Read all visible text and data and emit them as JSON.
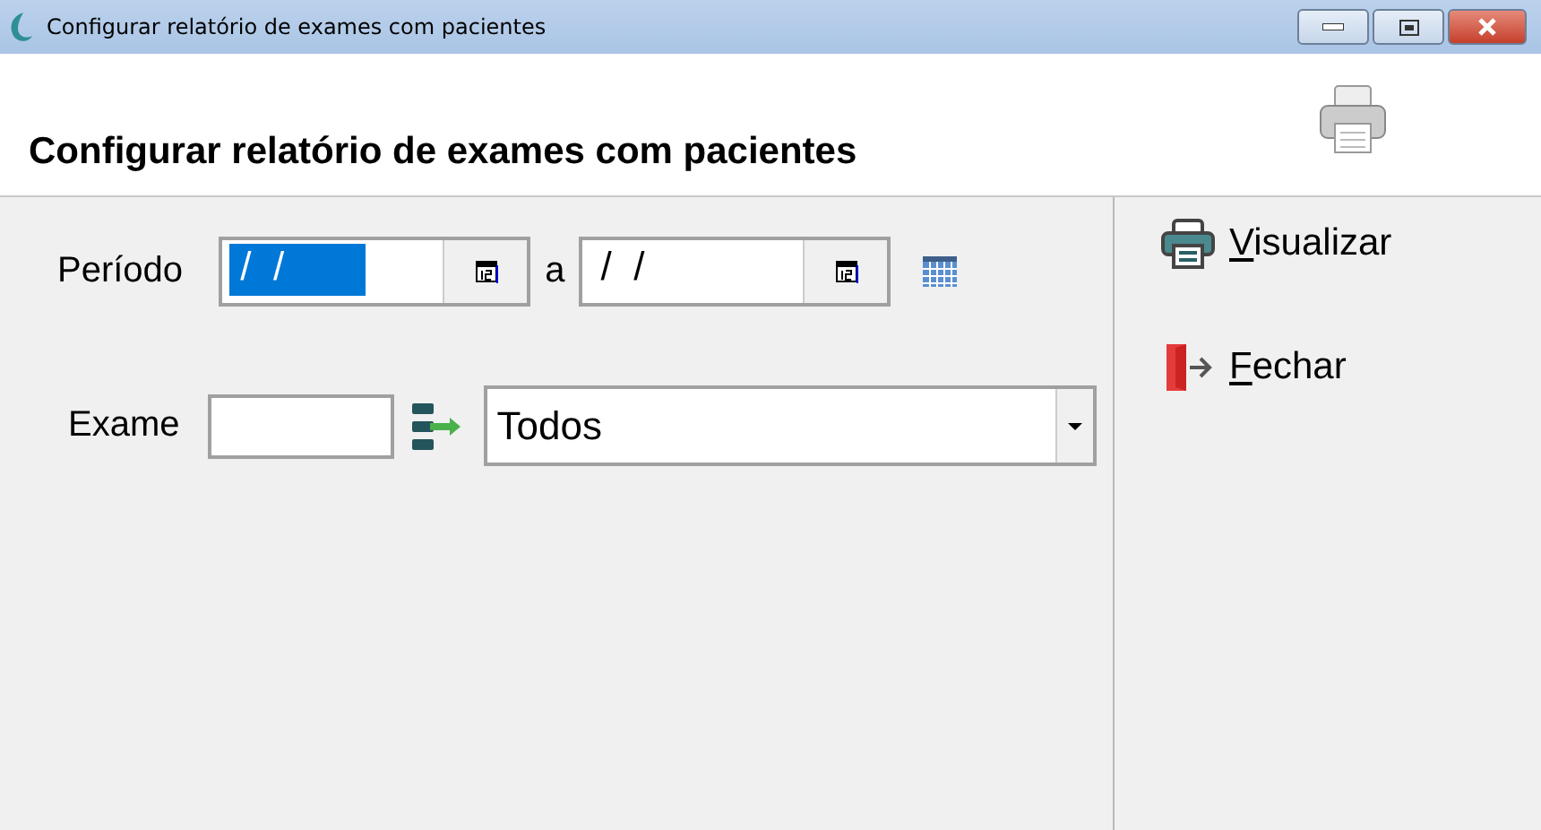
{
  "window": {
    "title": "Configurar relatório de exames com pacientes"
  },
  "header": {
    "title": "Configurar relatório de exames com pacientes"
  },
  "period": {
    "label": "Período",
    "separator": "a",
    "fields": [
      {
        "value": " /  /",
        "selected": true
      },
      {
        "value": " /  /",
        "selected": false
      }
    ]
  },
  "exam": {
    "label": "Exame",
    "dropdown": {
      "value": "Todos"
    }
  },
  "actions": [
    {
      "kind": "print",
      "label": "Visualizar"
    },
    {
      "kind": "exit",
      "label": "Fechar"
    }
  ]
}
